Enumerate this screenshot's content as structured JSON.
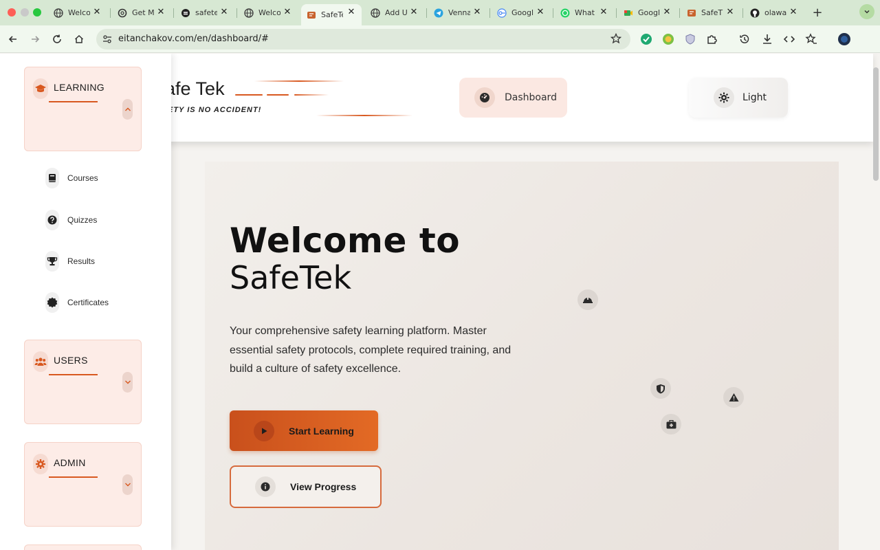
{
  "browser": {
    "tabs": [
      {
        "title": "Welco",
        "favicon": "globe-icon"
      },
      {
        "title": "Get M",
        "favicon": "openai-icon"
      },
      {
        "title": "safete",
        "favicon": "safetek-icon"
      },
      {
        "title": "Welco",
        "favicon": "globe-icon"
      },
      {
        "title": "SafeTe",
        "favicon": "safetek-logo-icon",
        "active": true
      },
      {
        "title": "Add U",
        "favicon": "globe-icon"
      },
      {
        "title": "Venna",
        "favicon": "telegram-icon"
      },
      {
        "title": "Googl",
        "favicon": "google-icon"
      },
      {
        "title": "What",
        "favicon": "whatsapp-icon"
      },
      {
        "title": "Googl",
        "favicon": "google-meet-icon"
      },
      {
        "title": "SafeT",
        "favicon": "safetek-logo-icon"
      },
      {
        "title": "olawa",
        "favicon": "github-icon"
      }
    ],
    "url": "eitanchakov.com/en/dashboard/#"
  },
  "header": {
    "logo_name": "afe Tek",
    "logo_tagline": "ETY IS NO ACCIDENT!",
    "nav_dashboard": "Dashboard",
    "theme_toggle": "Light"
  },
  "sidebar": {
    "learning": {
      "title": "LEARNING",
      "items": [
        "Courses",
        "Quizzes",
        "Results",
        "Certificates"
      ]
    },
    "users": {
      "title": "USERS"
    },
    "admin": {
      "title": "ADMIN"
    }
  },
  "hero": {
    "title_line1": "Welcome to",
    "title_line2": "SafeTek",
    "description": "Your comprehensive safety learning platform. Master essential safety protocols, complete required training, and build a culture of safety excellence.",
    "start_button": "Start Learning",
    "progress_button": "View Progress",
    "floating_icons": [
      "hard-hat-icon",
      "shield-icon",
      "warning-icon",
      "first-aid-icon"
    ]
  },
  "colors": {
    "accent": "#d8581f",
    "accent_light": "#fdece7",
    "tabbar": "#d7e8d3"
  }
}
